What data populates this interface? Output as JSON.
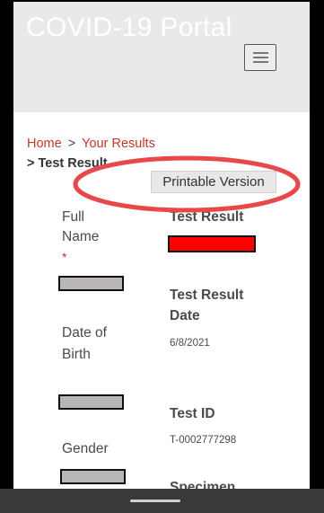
{
  "header": {
    "title": "COVID-19 Portal",
    "menu_icon": "hamburger-menu-icon"
  },
  "breadcrumb": {
    "items": [
      "Home",
      "Your Results"
    ],
    "separator": ">",
    "current": "> Test Result"
  },
  "print_button": {
    "label": "Printable Version"
  },
  "left_column": {
    "full_name_label_line1": "Full",
    "full_name_label_line2": "Name",
    "required_marker": "*",
    "dob_label_line1": "Date of",
    "dob_label_line2": "Birth",
    "gender_label": "Gender"
  },
  "right_column": {
    "test_result_label": "Test Result",
    "test_result_date_label_line1": "Test Result",
    "test_result_date_label_line2": "Date",
    "test_result_date_value": "6/8/2021",
    "test_id_label": "Test ID",
    "test_id_value": "T-0002777298",
    "specimen_label": "Specimen"
  },
  "colors": {
    "link": "#c0392b",
    "annotation": "#e8484a",
    "redaction_red": "#ff0000",
    "redaction_gray": "#b9b5b8"
  }
}
